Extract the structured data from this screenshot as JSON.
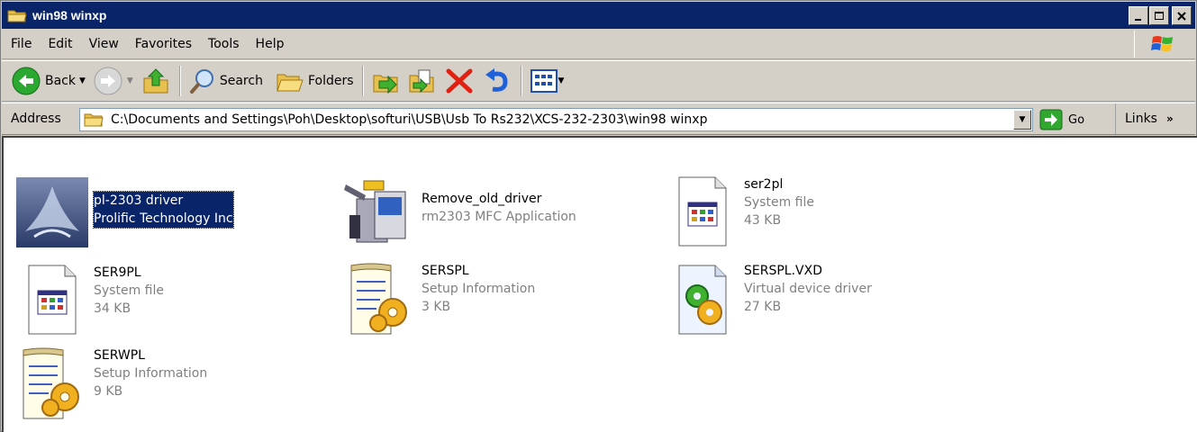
{
  "window": {
    "title": "win98 winxp",
    "buttons": {
      "minimize": "_",
      "maximize": "□",
      "close": "×"
    }
  },
  "menu": [
    "File",
    "Edit",
    "View",
    "Favorites",
    "Tools",
    "Help"
  ],
  "toolbar": {
    "back_label": "Back",
    "search_label": "Search",
    "folders_label": "Folders"
  },
  "address": {
    "label": "Address",
    "path": "C:\\Documents and Settings\\Poh\\Desktop\\softuri\\USB\\Usb To Rs232\\XCS-232-2303\\win98 winxp",
    "go_label": "Go",
    "links_label": "Links",
    "links_chevron": "»"
  },
  "files": [
    {
      "name": "pl-2303 driver",
      "line2": "Prolific Technology Inc",
      "line3": "",
      "icon": "installer-icon",
      "selected": true
    },
    {
      "name": "Remove_old_driver",
      "line2": "rm2303 MFC Application",
      "line3": "",
      "icon": "computer-tools-icon",
      "selected": false
    },
    {
      "name": "ser2pl",
      "line2": "System file",
      "line3": "43 KB",
      "icon": "system-file-icon",
      "selected": false
    },
    {
      "name": "SER9PL",
      "line2": "System file",
      "line3": "34 KB",
      "icon": "system-file-icon",
      "selected": false
    },
    {
      "name": "SERSPL",
      "line2": "Setup Information",
      "line3": "3 KB",
      "icon": "setup-info-icon",
      "selected": false
    },
    {
      "name": "SERSPL.VXD",
      "line2": "Virtual device driver",
      "line3": "27 KB",
      "icon": "device-driver-icon",
      "selected": false
    },
    {
      "name": "SERWPL",
      "line2": "Setup Information",
      "line3": "9 KB",
      "icon": "setup-info-icon",
      "selected": false
    }
  ]
}
